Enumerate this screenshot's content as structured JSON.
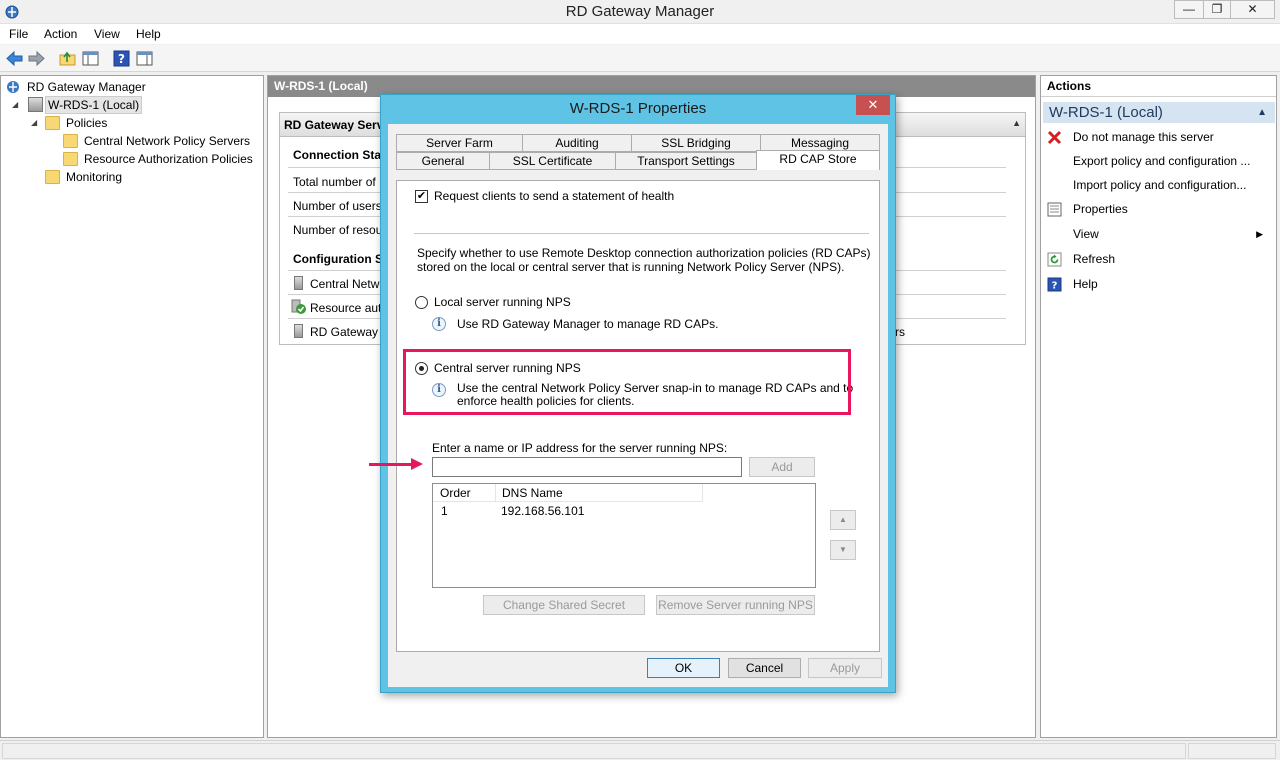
{
  "window": {
    "title": "RD Gateway Manager",
    "minimize_glyph": "—",
    "maximize_glyph": "❐",
    "close_glyph": "✕"
  },
  "menu": {
    "file": "File",
    "action": "Action",
    "view": "View",
    "help": "Help"
  },
  "tree": {
    "root": "RD Gateway Manager",
    "server": "W-RDS-1 (Local)",
    "policies": "Policies",
    "central_nps": "Central Network Policy Servers",
    "rap": "Resource Authorization Policies",
    "monitoring": "Monitoring"
  },
  "center": {
    "header": "W-RDS-1 (Local)",
    "panel_title": "RD Gateway Serv",
    "connection_status": "Connection Stat",
    "total_number": "Total number of",
    "number_users": "Number of users",
    "number_resources": "Number of resou",
    "configuration_status": "Configuration St",
    "central_network": "Central Netwo",
    "resource_auth": "Resource auth",
    "rd_gateway": "RD Gateway s",
    "trailing_rs": "rs"
  },
  "actions": {
    "header": "Actions",
    "section": "W-RDS-1 (Local)",
    "items": [
      {
        "label": "Do not manage this server",
        "icon": "red-x-icon"
      },
      {
        "label": "Export policy and configuration ...",
        "icon": "none"
      },
      {
        "label": "Import policy and configuration...",
        "icon": "none"
      },
      {
        "label": "Properties",
        "icon": "properties-icon"
      },
      {
        "label": "View",
        "icon": "none"
      },
      {
        "label": "Refresh",
        "icon": "refresh-icon"
      },
      {
        "label": "Help",
        "icon": "help-icon"
      }
    ]
  },
  "dialog": {
    "title": "W-RDS-1 Properties",
    "close_glyph": "✕",
    "tabs_row1": [
      "Server Farm",
      "Auditing",
      "SSL Bridging",
      "Messaging"
    ],
    "tabs_row2": [
      "General",
      "SSL Certificate",
      "Transport Settings",
      "RD CAP Store"
    ],
    "request_health": "Request clients to send a statement of health",
    "specify_line1": "Specify whether to use Remote Desktop connection authorization policies (RD CAPs)",
    "specify_line2": "stored on the local or central server that is running Network Policy Server (NPS).",
    "local_option": "Local server running NPS",
    "local_info": "Use RD Gateway Manager to manage RD CAPs.",
    "central_option": "Central server running NPS",
    "central_info_line1": "Use the central Network Policy Server snap-in to manage RD CAPs and to",
    "central_info_line2": "enforce health policies for clients.",
    "enter_label": "Enter a name or IP address for the server running NPS:",
    "server_input_value": "",
    "add_button": "Add",
    "col_order": "Order",
    "col_dns": "DNS Name",
    "rows": [
      {
        "order": "1",
        "dns": "192.168.56.101"
      }
    ],
    "change_secret": "Change Shared Secret",
    "remove_server": "Remove Server running NPS",
    "ok": "OK",
    "cancel": "Cancel",
    "apply": "Apply",
    "request_health_checked": true,
    "selected_option": "central"
  },
  "colors": {
    "highlight": "#e8175d",
    "dialog_frame": "#5ec3e5",
    "actions_section_bg": "#d6e4f1"
  }
}
